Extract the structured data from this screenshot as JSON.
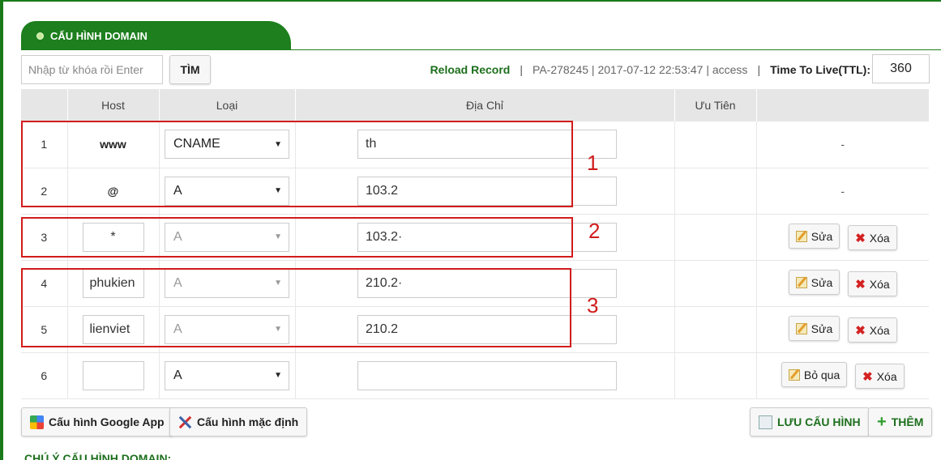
{
  "panel": {
    "title": "CẤU HÌNH DOMAIN"
  },
  "search": {
    "placeholder": "Nhập từ khóa rồi Enter",
    "button_label": "TÌM"
  },
  "toolbar": {
    "reload_label": "Reload Record",
    "record_info": "PA-278245 | 2017-07-12 22:53:47 | access",
    "ttl_label": "Time To Live(TTL):",
    "ttl_value": "360"
  },
  "table": {
    "headers": [
      "",
      "Host",
      "Loại",
      "Địa Chỉ",
      "Ưu Tiên",
      ""
    ],
    "rows": [
      {
        "num": "1",
        "host": "www",
        "type": "CNAME",
        "address": "th",
        "priority": "",
        "action": "-"
      },
      {
        "num": "2",
        "host": "@",
        "type": "A",
        "address": "103.2",
        "priority": "",
        "action": "-"
      },
      {
        "num": "3",
        "host": "*",
        "type": "A",
        "address": "103.2·",
        "priority": "",
        "edit_label": "Sửa",
        "delete_label": "Xóa"
      },
      {
        "num": "4",
        "host": "phukien",
        "type": "A",
        "address": "210.2·",
        "priority": "",
        "edit_label": "Sửa",
        "delete_label": "Xóa"
      },
      {
        "num": "5",
        "host": "lienviet",
        "type": "A",
        "address": "210.2",
        "priority": "",
        "edit_label": "Sửa",
        "delete_label": "Xóa"
      },
      {
        "num": "6",
        "host": "",
        "type": "A",
        "address": "",
        "priority": "",
        "edit_label": "Bỏ qua",
        "delete_label": "Xóa"
      }
    ]
  },
  "annotations": [
    "1",
    "2",
    "3"
  ],
  "buttons": {
    "google_app": "Cấu hình Google App",
    "default_config": "Cấu hình mặc định",
    "save": "LƯU CẤU HÌNH",
    "add": "THÊM"
  },
  "footer": {
    "title": "CHÚ Ý CẤU HÌNH DOMAIN:"
  },
  "colors": {
    "brand_green": "#1d7f1d",
    "annotation_red": "#d11c1c"
  }
}
